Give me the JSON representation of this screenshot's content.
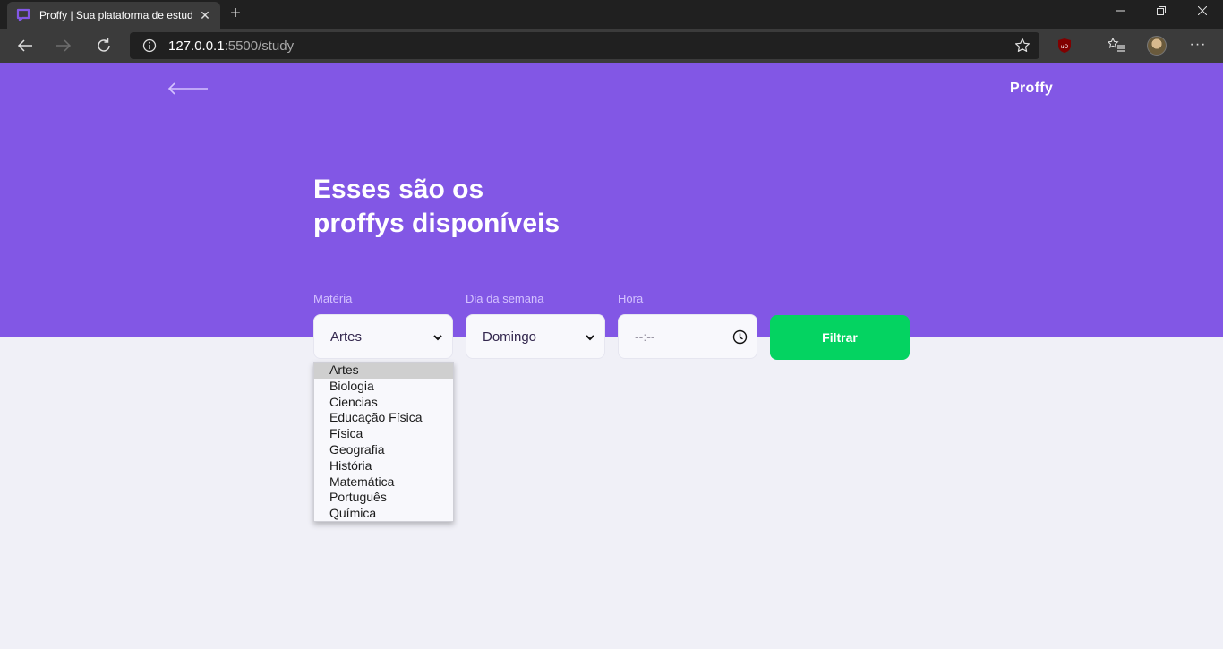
{
  "browser": {
    "tab_title": "Proffy | Sua plataforma de estudos",
    "new_tab_symbol": "+",
    "url_host": "127.0.0.1",
    "url_rest": ":5500/study",
    "more_symbol": "···"
  },
  "page": {
    "logo": "Proffy",
    "headline_line1": "Esses são os",
    "headline_line2": "proffys disponíveis",
    "filters": {
      "subject_label": "Matéria",
      "subject_value": "Artes",
      "weekday_label": "Dia da semana",
      "weekday_value": "Domingo",
      "time_label": "Hora",
      "time_placeholder": "--:--",
      "submit_label": "Filtrar"
    },
    "subject_options": [
      "Artes",
      "Biologia",
      "Ciencias",
      "Educação Física",
      "Física",
      "Geografia",
      "História",
      "Matemática",
      "Português",
      "Química"
    ]
  },
  "colors": {
    "primary": "#8257e5",
    "secondary": "#04d361",
    "background": "#f0f0f7"
  }
}
